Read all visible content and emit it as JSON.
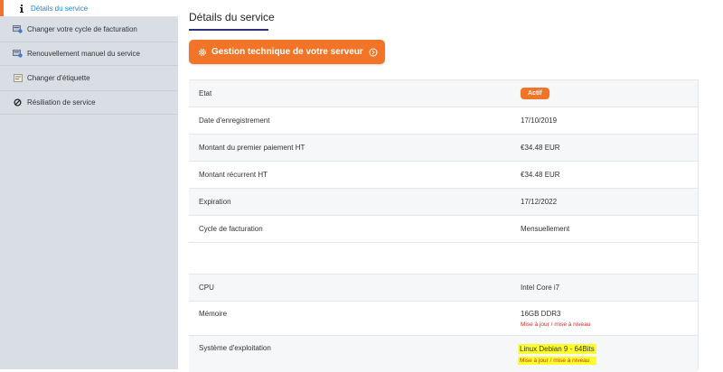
{
  "sidebar": {
    "items": [
      {
        "label": "Détails du service",
        "icon": "info-icon"
      },
      {
        "label": "Changer votre cycle de facturation",
        "icon": "billing-cycle-icon"
      },
      {
        "label": "Renouvellement manuel du service",
        "icon": "renew-icon"
      },
      {
        "label": "Changer d'étiquette",
        "icon": "label-icon"
      },
      {
        "label": "Résiliation de service",
        "icon": "ban-icon"
      }
    ]
  },
  "main": {
    "title": "Détails du service",
    "tech_button": "Gestion technique de votre serveur",
    "details": [
      {
        "label": "Etat",
        "value": "Actif"
      },
      {
        "label": "Date d'enregistrement",
        "value": "17/10/2019"
      },
      {
        "label": "Montant du premier paiement HT",
        "value": "€34.48 EUR"
      },
      {
        "label": "Montant récurrent HT",
        "value": "€34.48 EUR"
      },
      {
        "label": "Expiration",
        "value": "17/12/2022"
      },
      {
        "label": "Cycle de facturation",
        "value": "Mensuellement"
      }
    ],
    "config": [
      {
        "label": "CPU",
        "value": "Intel Core i7"
      },
      {
        "label": "Mémoire",
        "value": "16GB DDR3",
        "upgrade": "Mise à jour / mise à niveau"
      },
      {
        "label": "Système d'exploitation",
        "value": "Linux Debian 9 - 64Bits",
        "upgrade": "Mise à jour / mise à niveau"
      }
    ]
  },
  "colors": {
    "accent": "#f27426",
    "link_active": "#1e88c7",
    "upgrade_link": "#d62b2b",
    "highlight": "#ffff2a",
    "sidebar_bg": "#d9dee4"
  }
}
